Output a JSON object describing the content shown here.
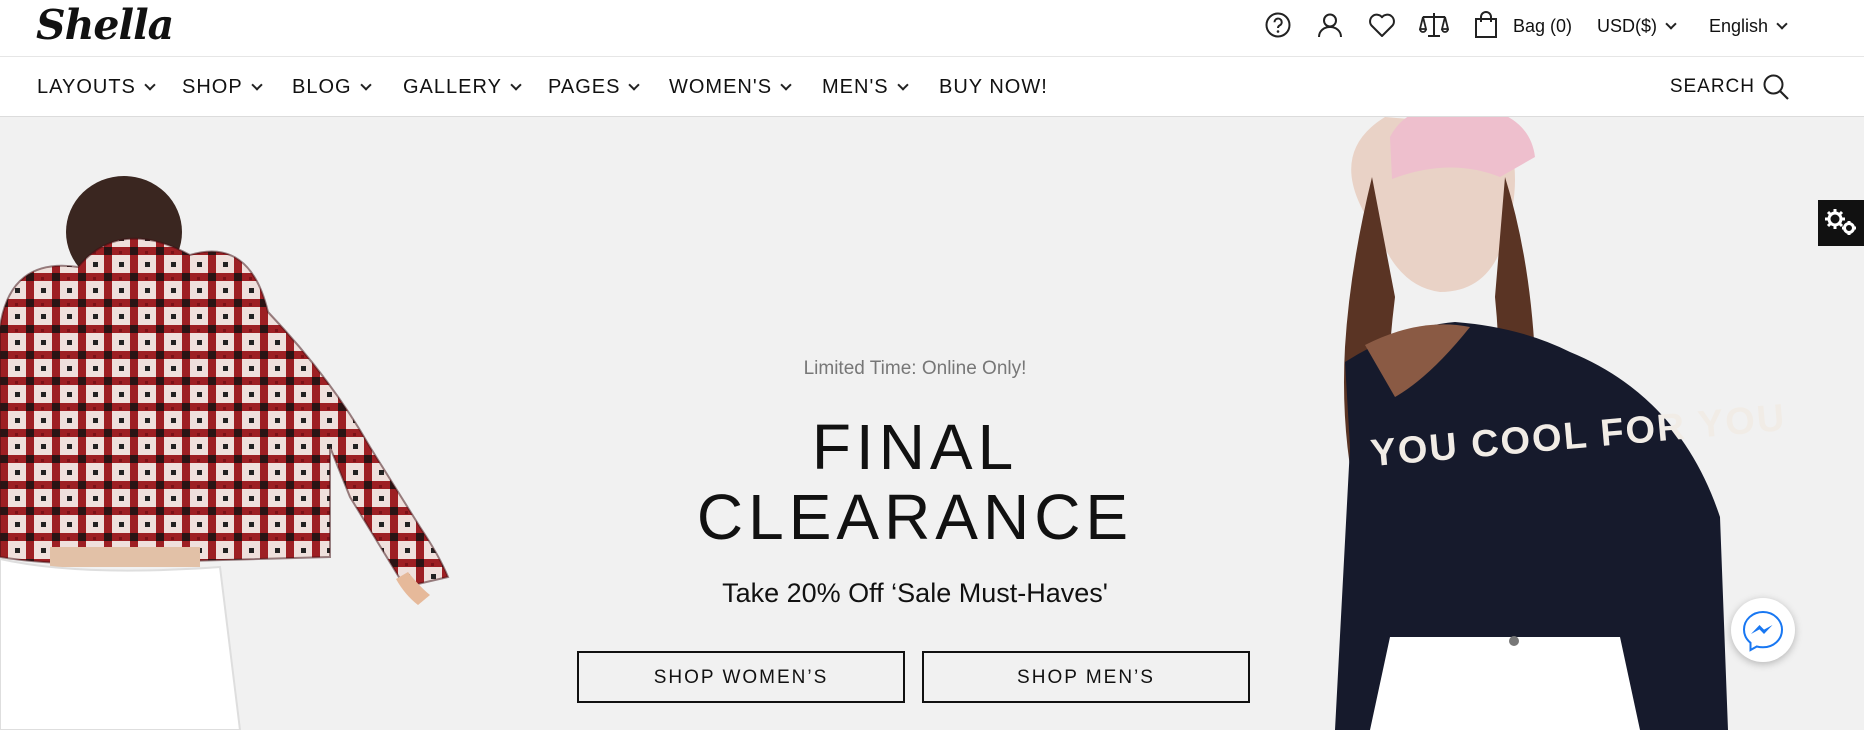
{
  "header": {
    "logo": "Shella",
    "bag_label": "Bag (0)",
    "currency": "USD($)",
    "language": "English",
    "icons": [
      "help-icon",
      "user-icon",
      "heart-icon",
      "compare-icon",
      "bag-icon"
    ]
  },
  "nav": {
    "items": [
      {
        "label": "LAYOUTS",
        "dropdown": true
      },
      {
        "label": "SHOP",
        "dropdown": true
      },
      {
        "label": "BLOG",
        "dropdown": true
      },
      {
        "label": "GALLERY",
        "dropdown": true
      },
      {
        "label": "PAGES",
        "dropdown": true
      },
      {
        "label": "WOMEN'S",
        "dropdown": true
      },
      {
        "label": "MEN'S",
        "dropdown": true
      },
      {
        "label": "BUY NOW!",
        "dropdown": false
      }
    ],
    "search_label": "SEARCH"
  },
  "hero": {
    "eyebrow": "Limited Time: Online Only!",
    "headline_line1": "FINAL",
    "headline_line2": "CLEARANCE",
    "subheadline": "Take 20% Off ‘Sale Must-Haves'",
    "buttons": [
      "SHOP WOMEN’S",
      "SHOP MEN’S"
    ],
    "model_sweater_text": "YOU COOL FOR YOU"
  },
  "widgets": {
    "settings_icon": "gears-icon",
    "chat_icon": "messenger-icon"
  },
  "colors": {
    "hero_background": "#f1f1f1",
    "text": "#111111",
    "messenger_blue": "#1877f2"
  }
}
